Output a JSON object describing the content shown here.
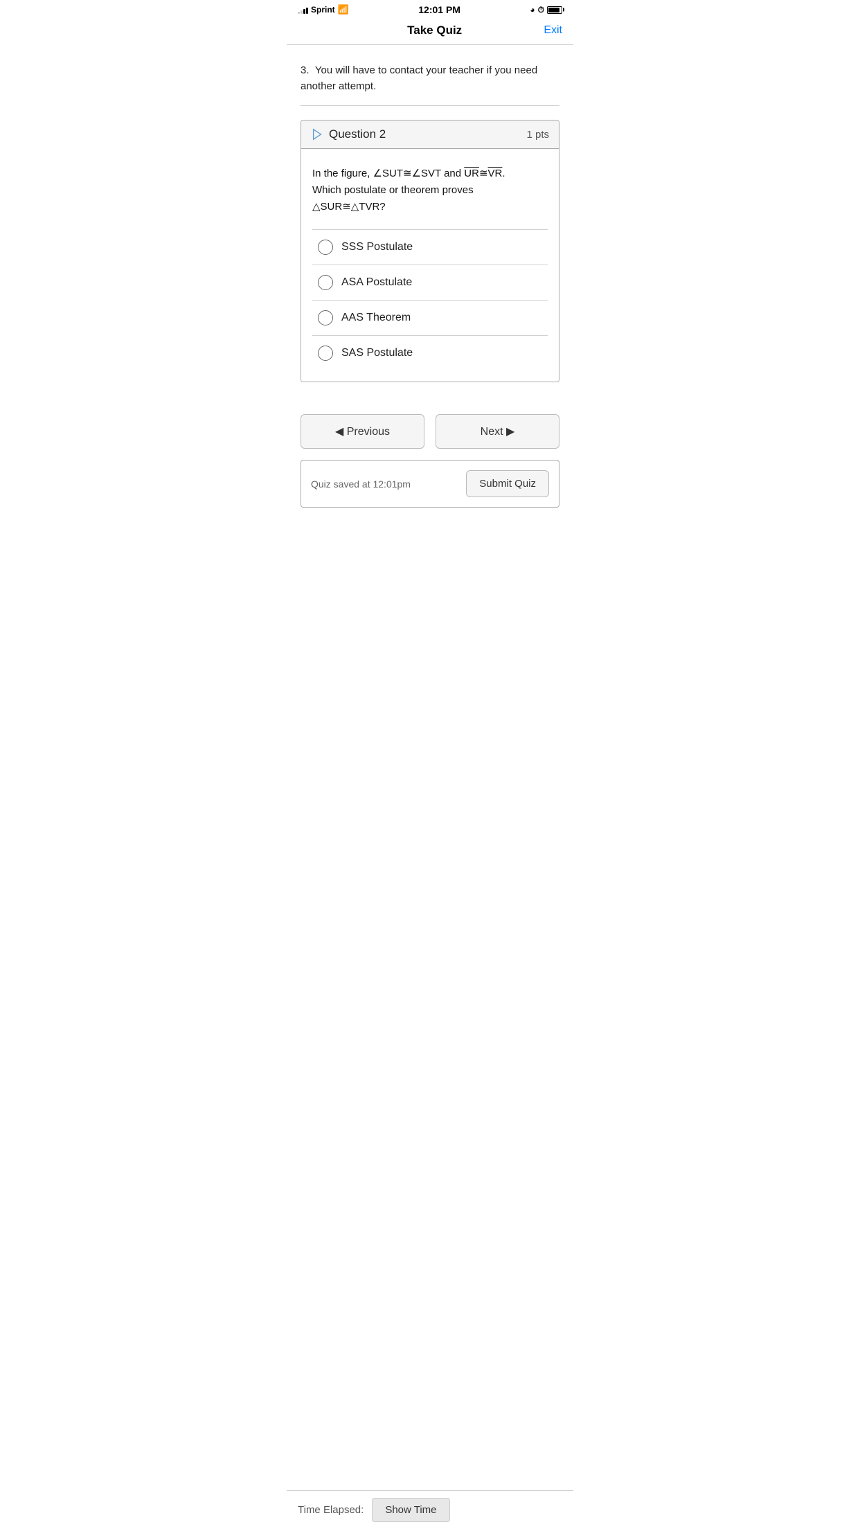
{
  "statusBar": {
    "carrier": "Sprint",
    "time": "12:01 PM",
    "icons": {
      "wifi": "wifi",
      "orientation": "⊕",
      "alarm": "⏰"
    }
  },
  "navBar": {
    "title": "Take Quiz",
    "exitLabel": "Exit"
  },
  "instructions": {
    "itemNumber": "3.",
    "text": "You will have to contact your teacher if you need another attempt."
  },
  "question": {
    "label": "Question 2",
    "points": "1 pts",
    "bodyLine1": "In the figure, ∠SUT≅∠SVT and ",
    "bodyLine1_part2": "UR",
    "bodyLine1_part3": "≅",
    "bodyLine1_part4": "VR",
    "bodyLine1_end": ".",
    "bodyLine2": "Which postulate or theorem proves △SUR≅△TVR?",
    "options": [
      {
        "id": "opt1",
        "label": "SSS Postulate"
      },
      {
        "id": "opt2",
        "label": "ASA Postulate"
      },
      {
        "id": "opt3",
        "label": "AAS Theorem"
      },
      {
        "id": "opt4",
        "label": "SAS Postulate"
      }
    ]
  },
  "navigation": {
    "previousLabel": "◀ Previous",
    "nextLabel": "Next ▶"
  },
  "saveBar": {
    "savedText": "Quiz saved at 12:01pm",
    "submitLabel": "Submit Quiz"
  },
  "footer": {
    "elapsedLabel": "Time Elapsed:",
    "showTimeLabel": "Show Time"
  }
}
